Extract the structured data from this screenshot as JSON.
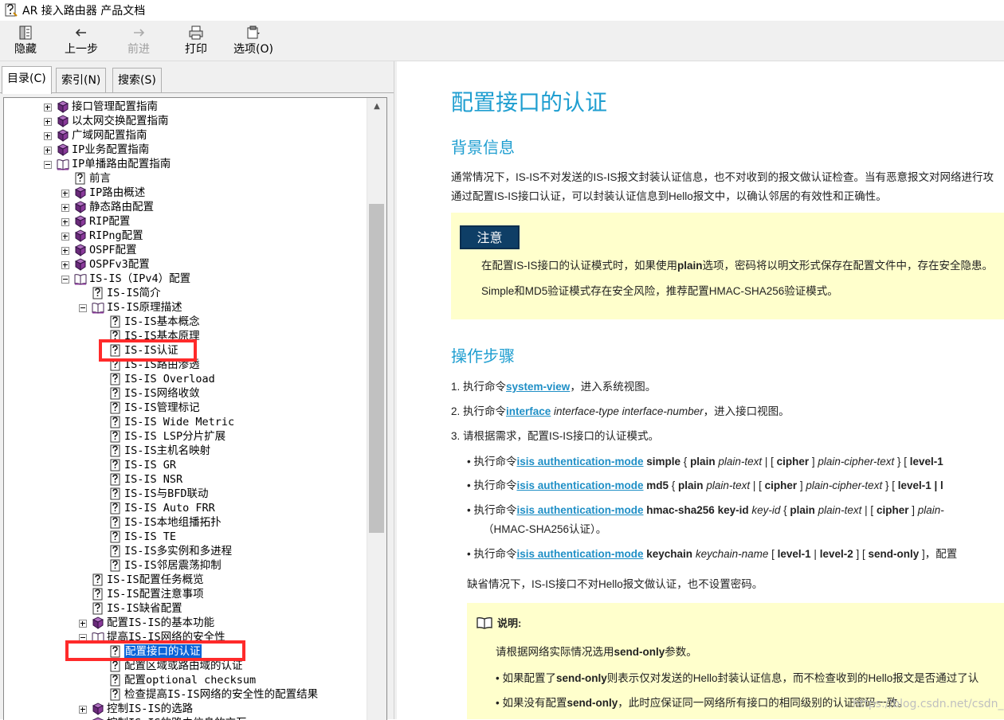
{
  "window": {
    "title": "AR 接入路由器 产品文档"
  },
  "toolbar": {
    "hide_label": "隐藏",
    "back_label": "上一步",
    "forward_label": "前进",
    "print_label": "打印",
    "options_label": "选项(O)"
  },
  "tabs": {
    "contents": "目录(C)",
    "index": "索引(N)",
    "search": "搜索(S)"
  },
  "tree": {
    "t0": "接口管理配置指南",
    "t1": "以太网交换配置指南",
    "t2": "广域网配置指南",
    "t3": "IP业务配置指南",
    "t4": "IP单播路由配置指南",
    "t5": "前言",
    "t6": "IP路由概述",
    "t7": "静态路由配置",
    "t8": "RIP配置",
    "t9": "RIPng配置",
    "t10": "OSPF配置",
    "t11": "OSPFv3配置",
    "t12": "IS-IS（IPv4）配置",
    "t13": "IS-IS简介",
    "t14": "IS-IS原理描述",
    "t15": "IS-IS基本概念",
    "t16": "IS-IS基本原理",
    "t17": "IS-IS认证",
    "t18": "IS-IS路由渗透",
    "t19": "IS-IS Overload",
    "t20": "IS-IS网络收敛",
    "t21": "IS-IS管理标记",
    "t22": "IS-IS Wide Metric",
    "t23": "IS-IS LSP分片扩展",
    "t24": "IS-IS主机名映射",
    "t25": "IS-IS GR",
    "t26": "IS-IS NSR",
    "t27": "IS-IS与BFD联动",
    "t28": "IS-IS Auto FRR",
    "t29": "IS-IS本地组播拓扑",
    "t30": "IS-IS TE",
    "t31": "IS-IS多实例和多进程",
    "t32": "IS-IS邻居震荡抑制",
    "t33": "IS-IS配置任务概览",
    "t34": "IS-IS配置注意事项",
    "t35": "IS-IS缺省配置",
    "t36": "配置IS-IS的基本功能",
    "t37": "提高IS-IS网络的安全性",
    "t38": "配置接口的认证",
    "t39": "配置区域或路由域的认证",
    "t40": "配置optional checksum",
    "t41": "检查提高IS-IS网络的安全性的配置结果",
    "t42": "控制IS-IS的选路",
    "t43": "控制IS-IS的路由信息的交互"
  },
  "content": {
    "title": "配置接口的认证",
    "bg_heading": "背景信息",
    "bg_line1": "通常情况下，IS-IS不对发送的IS-IS报文封装认证信息，也不对收到的报文做认证检查。当有恶意报文对网络进行攻",
    "bg_line2": "通过配置IS-IS接口认证，可以封装认证信息到Hello报文中，以确认邻居的有效性和正确性。",
    "notice_badge": "注意",
    "notice_line1_a": "在配置IS-IS接口的认证模式时，如果使用",
    "notice_line1_b": "plain",
    "notice_line1_c": "选项，密码将以明文形式保存在配置文件中，存在安全隐患。",
    "notice_line2": "Simple和MD5验证模式存在安全风险，推荐配置HMAC-SHA256验证模式。",
    "steps_heading": "操作步骤",
    "s1_a": "1.  执行命令",
    "s1_cmd": "system-view",
    "s1_b": "，进入系统视图。",
    "s2_a": "2.  执行命令",
    "s2_cmd": "interface",
    "s2_arg": " interface-type interface-number",
    "s2_b": "，进入接口视图。",
    "s3": "3.  请根据需求，配置IS-IS接口的认证模式。",
    "b_prefix": "•  执行命令",
    "b_cmd": "isis authentication-mode",
    "b1_mode": " simple",
    "b1_rest1": " { ",
    "b1_plain": "plain",
    "b1_arg": " plain-text",
    "b1_rest2": " | [ ",
    "b1_cipher": "cipher",
    "b1_rest3": " ] ",
    "b1_arg2": "plain-cipher-text",
    "b1_rest4": " } [ ",
    "b1_level": "level-1",
    "b2_mode": " md5",
    "b2_level": "level-1 | l",
    "b3_mode": " hmac-sha256 key-id",
    "b3_keyid": " key-id",
    "b3_rest": " { ",
    "b3_plain": "plain",
    "b3_arg": " plain-text",
    "b3_rest2": " | [ ",
    "b3_cipher": "cipher",
    "b3_rest3": " ] ",
    "b3_arg2": "plain-",
    "b3_line2": "（HMAC-SHA256认证）。",
    "b4_mode": " keychain",
    "b4_arg": " keychain-name",
    "b4_rest": " [ ",
    "b4_l1": "level-1",
    "b4_sep": " | ",
    "b4_l2": "level-2",
    "b4_rest2": " ] [ ",
    "b4_so": "send-only",
    "b4_rest3": " ]，配置",
    "default_line": "缺省情况下，IS-IS接口不对Hello报文做认证，也不设置密码。",
    "note_head": "说明:",
    "note_l1_a": "请根据网络实际情况选用",
    "note_l1_b": "send-only",
    "note_l1_c": "参数。",
    "note_l2_a": "•  如果配置了",
    "note_l2_b": "send-only",
    "note_l2_c": "则表示仅对发送的Hello封装认证信息，而不检查收到的Hello报文是否通过了认",
    "note_l3_a": "•  如果没有配置",
    "note_l3_b": "send-only",
    "note_l3_c": "，此时应保证同一网络所有接口的相同级别的认证密码一致。"
  },
  "watermark": "https://blog.csdn.net/csdn_immortal",
  "colors": {
    "heading": "#1f9ed0",
    "selection": "#0a64d8",
    "highlight_box": "#ff2a2a",
    "notice_bg": "#ffffcc",
    "badge_bg": "#0e3e66"
  }
}
